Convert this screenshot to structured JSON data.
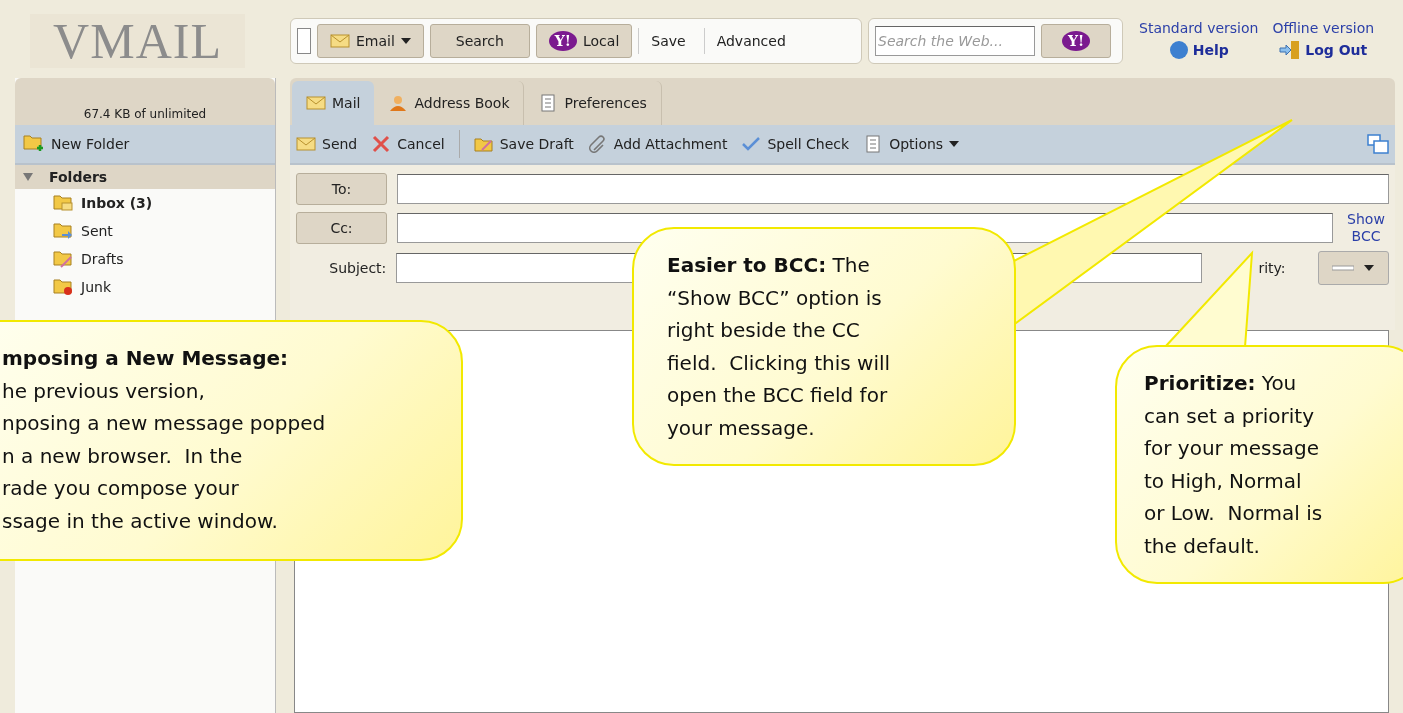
{
  "logo": {
    "text": "VMAIL"
  },
  "search_bar": {
    "scope": "Email",
    "search": "Search",
    "local_mark": "Y!",
    "local": "Local",
    "links": [
      "Save",
      "Advanced"
    ]
  },
  "web_search": {
    "placeholder": "Search the Web...",
    "button_mark": "Y!"
  },
  "top_links": [
    "Standard version",
    "Offline version"
  ],
  "help": "Help",
  "logout": "Log Out",
  "storage": "67.4 KB of unlimited",
  "new_folder": "New Folder",
  "folders": {
    "title": "Folders",
    "expanded": true,
    "items": [
      {
        "name": "Inbox (3)",
        "kind": "inbox",
        "unread": true
      },
      {
        "name": "Sent",
        "kind": "sent",
        "unread": false
      },
      {
        "name": "Drafts",
        "kind": "drafts",
        "unread": false
      },
      {
        "name": "Junk",
        "kind": "junk",
        "unread": false
      }
    ]
  },
  "tabs": [
    {
      "label": "Mail",
      "kind": "mail",
      "selected": true
    },
    {
      "label": "Address Book",
      "kind": "person",
      "selected": false
    },
    {
      "label": "Preferences",
      "kind": "list",
      "selected": false
    }
  ],
  "toolbar": [
    {
      "label": "Send",
      "kind": "mail"
    },
    {
      "label": "Cancel",
      "kind": "cross"
    },
    {
      "label": "Save Draft",
      "kind": "draft"
    },
    {
      "label": "Add Attachment",
      "kind": "clip"
    },
    {
      "label": "Spell Check",
      "kind": "check"
    },
    {
      "label": "Options",
      "kind": "list",
      "menu": true
    }
  ],
  "compose": {
    "to": "To:",
    "cc": "Cc:",
    "show_bcc": "Show BCC",
    "subject": "Subject:",
    "priority": "rity:"
  },
  "callouts": [
    {
      "kind": "left",
      "title": "mposing a New Message:",
      "lines": [
        "he previous version,",
        "nposing a new message popped",
        "n a new browser.  In the",
        "rade you compose your",
        "ssage in the active window."
      ]
    },
    {
      "kind": "middle",
      "text": "**Easier to BCC:** The\n“Show BCC” option is\nright beside the CC\nfield.  Clicking this will\nopen the BCC field for\nyour message."
    },
    {
      "kind": "right",
      "text": "**Prioritize:** You\ncan set a priority\nfor your message\nto High, Normal\nor Low.  Normal is\nthe default."
    }
  ]
}
